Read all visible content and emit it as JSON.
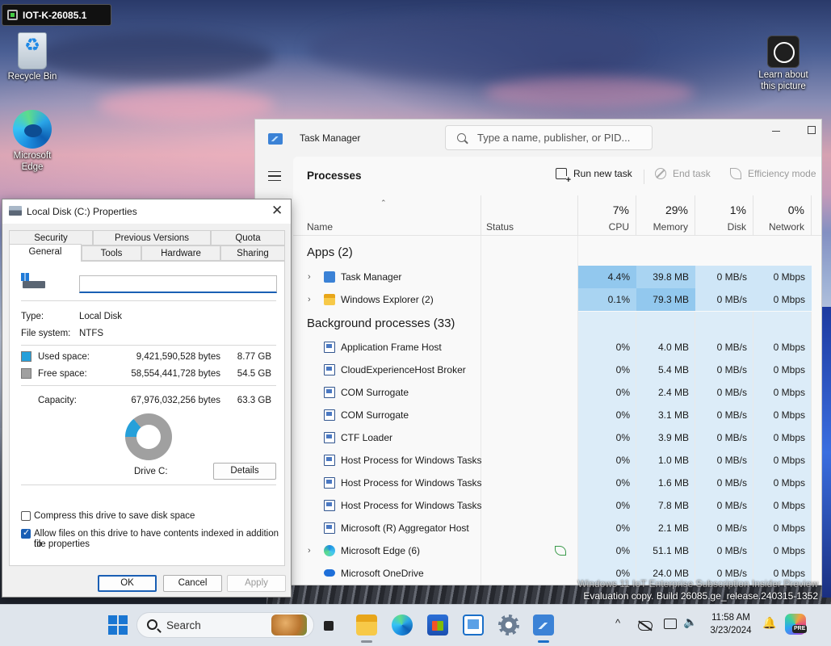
{
  "vm_title": "IOT-K-26085.1",
  "desktop": {
    "icons": [
      {
        "label": "Recycle Bin",
        "icon": "recycle-bin-icon"
      },
      {
        "label": "Microsoft Edge",
        "icon": "edge-icon"
      },
      {
        "label_line1": "Learn about",
        "label_line2": "this picture",
        "icon": "learn-about-picture-icon"
      }
    ]
  },
  "watermark": {
    "line1": "Windows 11 IoT Enterprise Subscription Insider Preview",
    "line2": "Evaluation copy. Build 26085.ge_release.240315-1352"
  },
  "task_manager": {
    "title": "Task Manager",
    "search_placeholder": "Type a name, publisher, or PID...",
    "page_title": "Processes",
    "commands": {
      "run_new_task": "Run new task",
      "end_task": "End task",
      "efficiency_mode": "Efficiency mode"
    },
    "columns": {
      "name": "Name",
      "status": "Status",
      "cpu": {
        "pct": "7%",
        "label": "CPU"
      },
      "memory": {
        "pct": "29%",
        "label": "Memory"
      },
      "disk": {
        "pct": "1%",
        "label": "Disk"
      },
      "network": {
        "pct": "0%",
        "label": "Network"
      }
    },
    "groups": {
      "apps": "Apps (2)",
      "background": "Background processes (33)"
    },
    "apps": [
      {
        "name": "Task Manager",
        "cpu": "4.4%",
        "mem": "39.8 MB",
        "disk": "0 MB/s",
        "net": "0 Mbps",
        "icon": "task-manager-icon"
      },
      {
        "name": "Windows Explorer (2)",
        "cpu": "0.1%",
        "mem": "79.3 MB",
        "disk": "0 MB/s",
        "net": "0 Mbps",
        "icon": "folder-icon"
      }
    ],
    "background": [
      {
        "name": "Application Frame Host",
        "cpu": "0%",
        "mem": "4.0 MB",
        "disk": "0 MB/s",
        "net": "0 Mbps"
      },
      {
        "name": "CloudExperienceHost Broker",
        "cpu": "0%",
        "mem": "5.4 MB",
        "disk": "0 MB/s",
        "net": "0 Mbps"
      },
      {
        "name": "COM Surrogate",
        "cpu": "0%",
        "mem": "2.4 MB",
        "disk": "0 MB/s",
        "net": "0 Mbps"
      },
      {
        "name": "COM Surrogate",
        "cpu": "0%",
        "mem": "3.1 MB",
        "disk": "0 MB/s",
        "net": "0 Mbps"
      },
      {
        "name": "CTF Loader",
        "cpu": "0%",
        "mem": "3.9 MB",
        "disk": "0 MB/s",
        "net": "0 Mbps"
      },
      {
        "name": "Host Process for Windows Tasks",
        "cpu": "0%",
        "mem": "1.0 MB",
        "disk": "0 MB/s",
        "net": "0 Mbps"
      },
      {
        "name": "Host Process for Windows Tasks",
        "cpu": "0%",
        "mem": "1.6 MB",
        "disk": "0 MB/s",
        "net": "0 Mbps"
      },
      {
        "name": "Host Process for Windows Tasks",
        "cpu": "0%",
        "mem": "7.8 MB",
        "disk": "0 MB/s",
        "net": "0 Mbps"
      },
      {
        "name": "Microsoft (R) Aggregator Host",
        "cpu": "0%",
        "mem": "2.1 MB",
        "disk": "0 MB/s",
        "net": "0 Mbps"
      },
      {
        "name": "Microsoft Edge (6)",
        "cpu": "0%",
        "mem": "51.1 MB",
        "disk": "0 MB/s",
        "net": "0 Mbps"
      },
      {
        "name": "Microsoft OneDrive",
        "cpu": "0%",
        "mem": "24.0 MB",
        "disk": "0 MB/s",
        "net": "0 Mbps"
      }
    ]
  },
  "properties": {
    "title": "Local Disk (C:) Properties",
    "tabs": {
      "security": "Security",
      "previous_versions": "Previous Versions",
      "quota": "Quota",
      "general": "General",
      "tools": "Tools",
      "hardware": "Hardware",
      "sharing": "Sharing"
    },
    "volume_name": "",
    "type_label": "Type:",
    "type_value": "Local Disk",
    "fs_label": "File system:",
    "fs_value": "NTFS",
    "used_label": "Used space:",
    "used_bytes": "9,421,590,528 bytes",
    "used_gb": "8.77 GB",
    "free_label": "Free space:",
    "free_bytes": "58,554,441,728 bytes",
    "free_gb": "54.5 GB",
    "capacity_label": "Capacity:",
    "capacity_bytes": "67,976,032,256 bytes",
    "capacity_gb": "63.3 GB",
    "used_fraction": 0.1386,
    "drive_label": "Drive C:",
    "details_button": "Details",
    "compress_label": "Compress this drive to save disk space",
    "compress_checked": false,
    "index_label_line1": "Allow files on this drive to have contents indexed in addition to",
    "index_label_line2": "file properties",
    "index_checked": true,
    "ok": "OK",
    "cancel": "Cancel",
    "apply": "Apply",
    "colors": {
      "used": "#26a0da",
      "free": "#a0a0a0"
    }
  },
  "taskbar": {
    "search_text": "Search",
    "time": "11:58 AM",
    "date": "3/23/2024",
    "tray_chevron": "^"
  }
}
